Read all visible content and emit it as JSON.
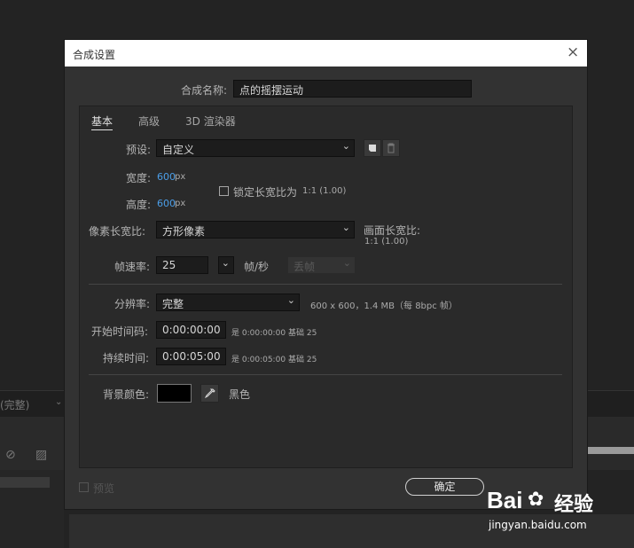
{
  "background": {
    "status_label": "(完整)",
    "status_caret": "⌄"
  },
  "dialog": {
    "title": "合成设置",
    "close_icon": "×",
    "name_label": "合成名称:",
    "name_value": "点的摇摆运动",
    "tabs": [
      {
        "label": "基本",
        "active": true
      },
      {
        "label": "高级",
        "active": false
      },
      {
        "label": "3D 渲染器",
        "active": false
      }
    ],
    "preset": {
      "label": "预设:",
      "value": "自定义"
    },
    "width": {
      "label": "宽度:",
      "value": "600",
      "unit": "px"
    },
    "height": {
      "label": "高度:",
      "value": "600",
      "unit": "px"
    },
    "lock_aspect": {
      "label": "锁定长宽比为",
      "ratio": "1:1 (1.00)",
      "checked": false
    },
    "pixel_aspect": {
      "label": "像素长宽比:",
      "value": "方形像素"
    },
    "frame_aspect": {
      "label": "画面长宽比:",
      "value": "1:1 (1.00)"
    },
    "frame_rate": {
      "label": "帧速率:",
      "value": "25",
      "unit": "帧/秒",
      "drop_frame": "丢帧"
    },
    "resolution": {
      "label": "分辨率:",
      "value": "完整",
      "info": "600 x 600，1.4 MB（每 8bpc 帧）"
    },
    "start_timecode": {
      "label": "开始时间码:",
      "value": "0:00:00:00",
      "info": "是 0:00:00:00",
      "base": "基础 25"
    },
    "duration": {
      "label": "持续时间:",
      "value": "0:00:05:00",
      "info": "是 0:00:05:00",
      "base": "基础 25"
    },
    "bg_color": {
      "label": "背景颜色:",
      "swatch": "#000000",
      "name": "黑色"
    },
    "preview": {
      "label": "预览",
      "checked": false
    },
    "ok_label": "确定"
  },
  "watermark": {
    "brand": "Bai",
    "brand2": "经验",
    "url": "jingyan.baidu.com"
  }
}
